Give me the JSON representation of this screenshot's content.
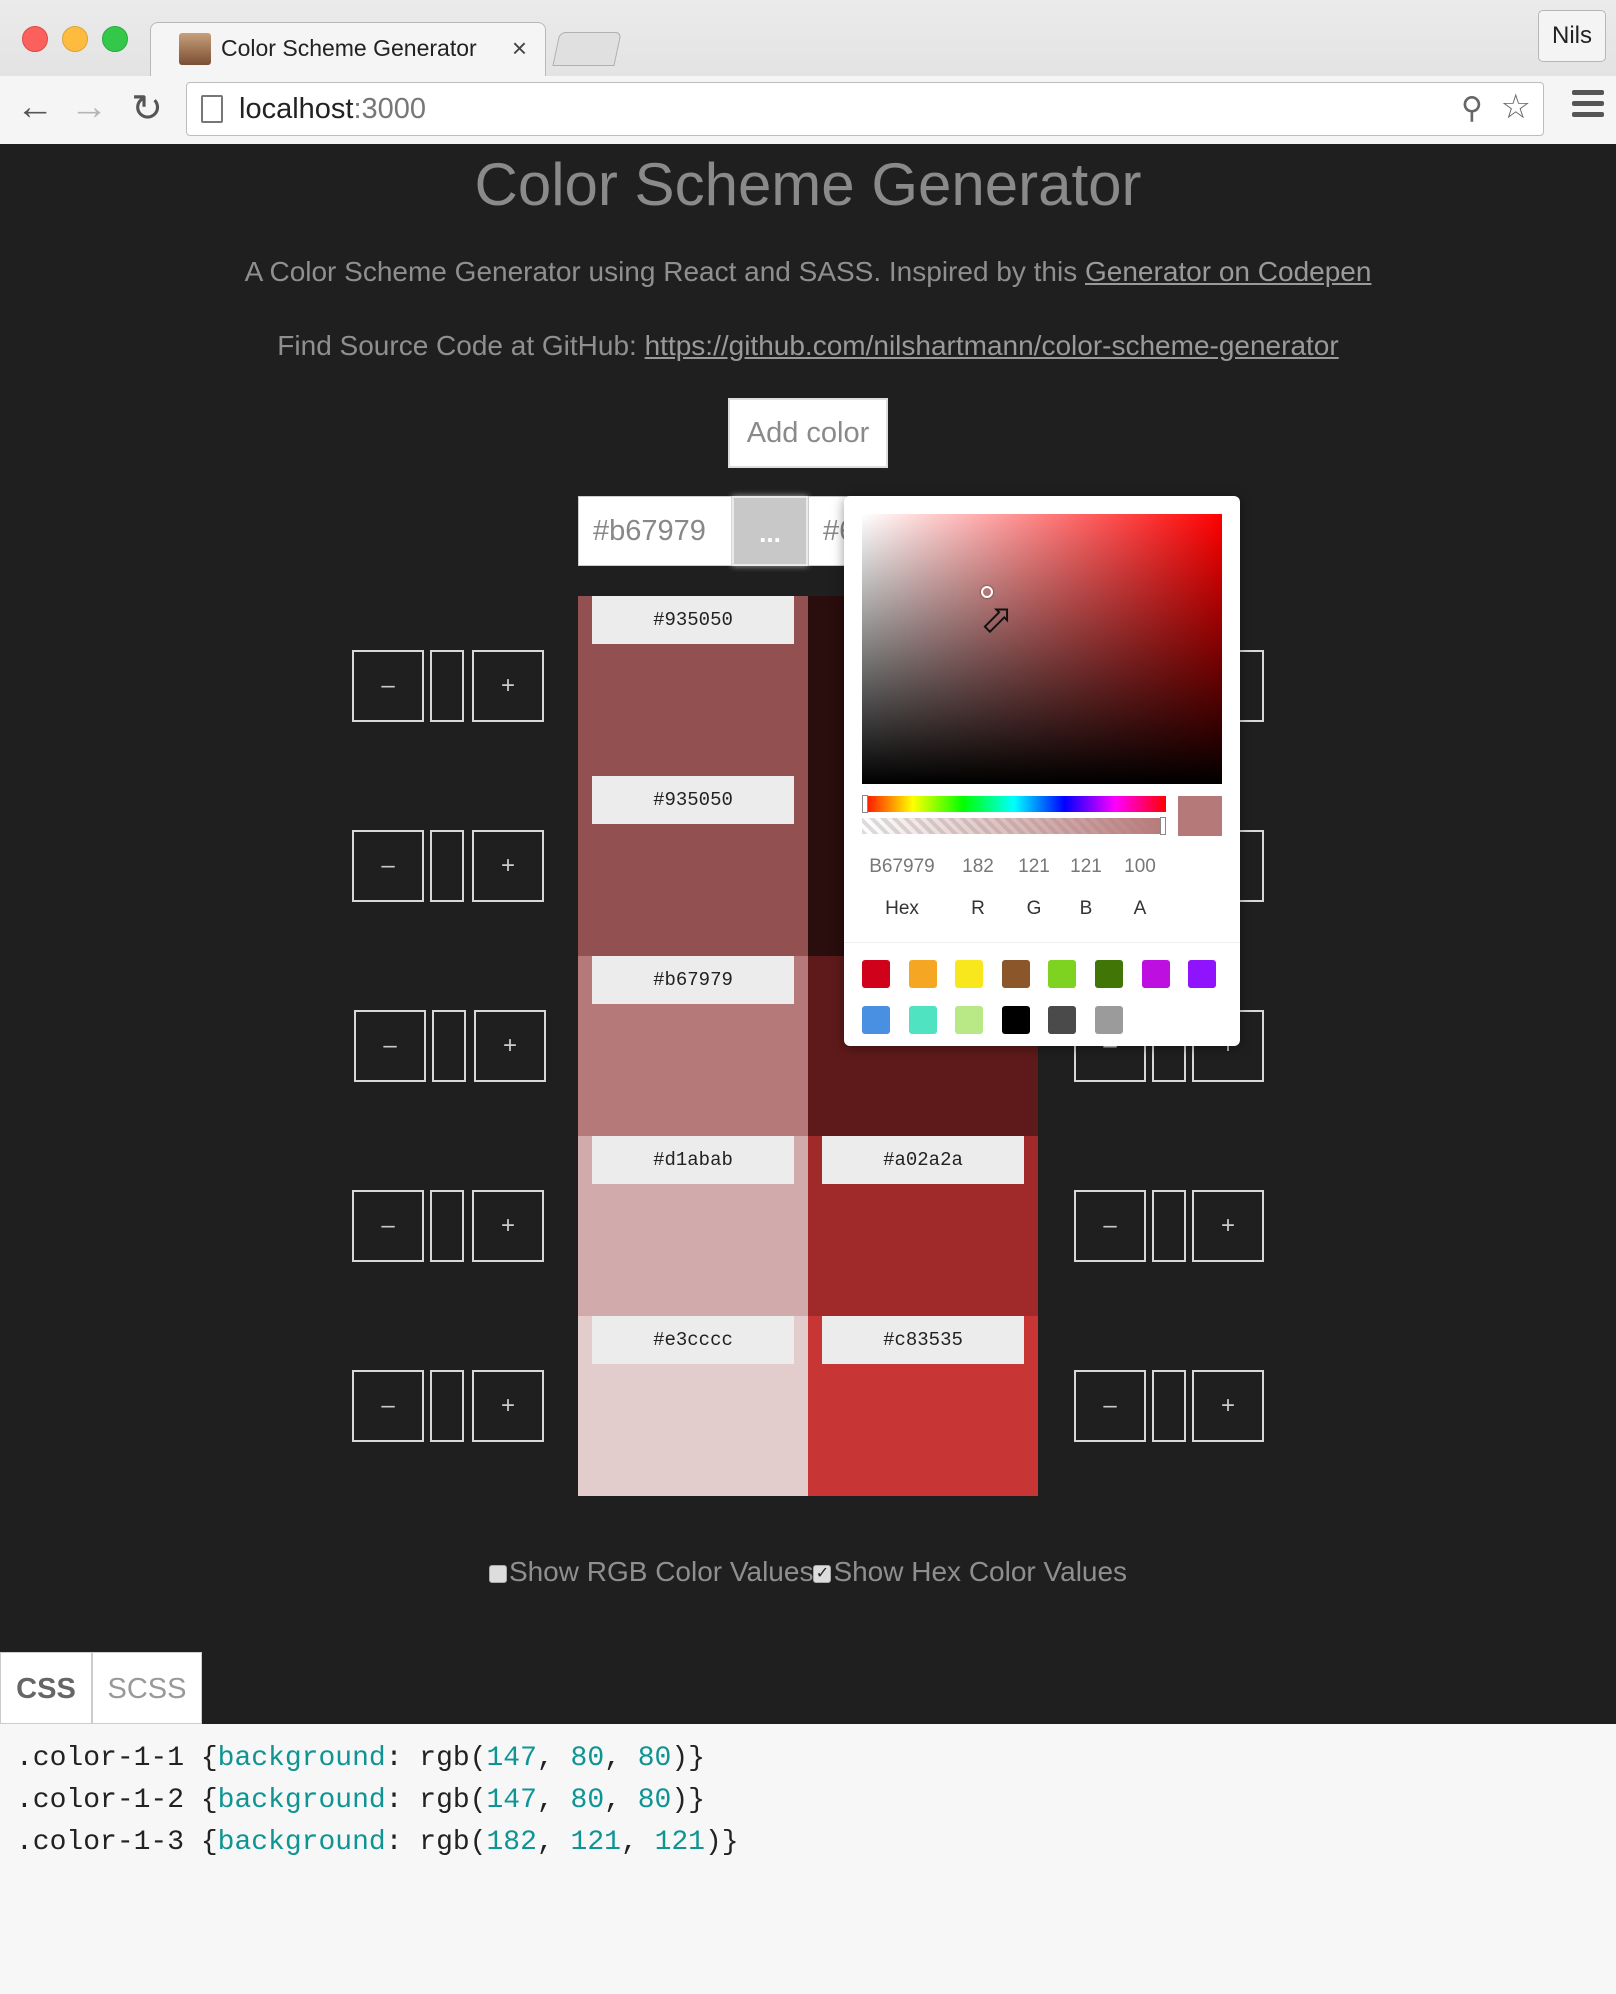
{
  "browser": {
    "tab_title": "Color Scheme Generator",
    "tab_close": "×",
    "profile": "Nils",
    "url_host": "localhost",
    "url_port": ":3000"
  },
  "page": {
    "title": "Color Scheme Generator",
    "intro_text": "A Color Scheme Generator using React and SASS. Inspired by this ",
    "intro_link": "Generator on Codepen",
    "source_text": "Find Source Code at GitHub: ",
    "source_link": "https://github.com/nilshartmann/color-scheme-generator",
    "add_color": "Add color"
  },
  "columns": [
    {
      "hex_input": "#b67979",
      "menu_button": "...",
      "swatches": [
        {
          "label": "#935050",
          "color": "#935050"
        },
        {
          "label": "#935050",
          "color": "#935050"
        },
        {
          "label": "#b67979",
          "color": "#b67979"
        },
        {
          "label": "#d1abab",
          "color": "#d1abab"
        },
        {
          "label": "#e3cccc",
          "color": "#e3cccc"
        }
      ]
    },
    {
      "hex_input": "#6",
      "swatches": [
        {
          "label": "",
          "color": "#2a0d0d"
        },
        {
          "label": "",
          "color": "#2a0d0d"
        },
        {
          "label": "",
          "color": "#5e1a1a"
        },
        {
          "label": "#a02a2a",
          "color": "#a02a2a"
        },
        {
          "label": "#c83535",
          "color": "#c83535"
        }
      ]
    }
  ],
  "controls": {
    "minus": "–",
    "plus": "+"
  },
  "options": {
    "show_rgb": "Show RGB Color Values",
    "show_hex": "Show Hex Color Values",
    "rgb_checked": false,
    "hex_checked": true
  },
  "code_tabs": [
    "CSS",
    "SCSS"
  ],
  "code_lines": [
    {
      "selector": ".color-1-1",
      "prop": "background",
      "r": "147",
      "g": "80",
      "b": "80"
    },
    {
      "selector": ".color-1-2",
      "prop": "background",
      "r": "147",
      "g": "80",
      "b": "80"
    },
    {
      "selector": ".color-1-3",
      "prop": "background",
      "r": "182",
      "g": "121",
      "b": "121"
    }
  ],
  "picker": {
    "hex": "B67979",
    "r": "182",
    "g": "121",
    "b": "121",
    "a": "100",
    "labels": [
      "Hex",
      "R",
      "G",
      "B",
      "A"
    ],
    "current_color": "#b67979",
    "presets": [
      "#d0021b",
      "#f5a623",
      "#f8e71c",
      "#8b572a",
      "#7ed321",
      "#417505",
      "#bd10e0",
      "#9013fe",
      "#4a90e2",
      "#50e3c2",
      "#b8e986",
      "#000000",
      "#4a4a4a",
      "#9b9b9b"
    ]
  }
}
